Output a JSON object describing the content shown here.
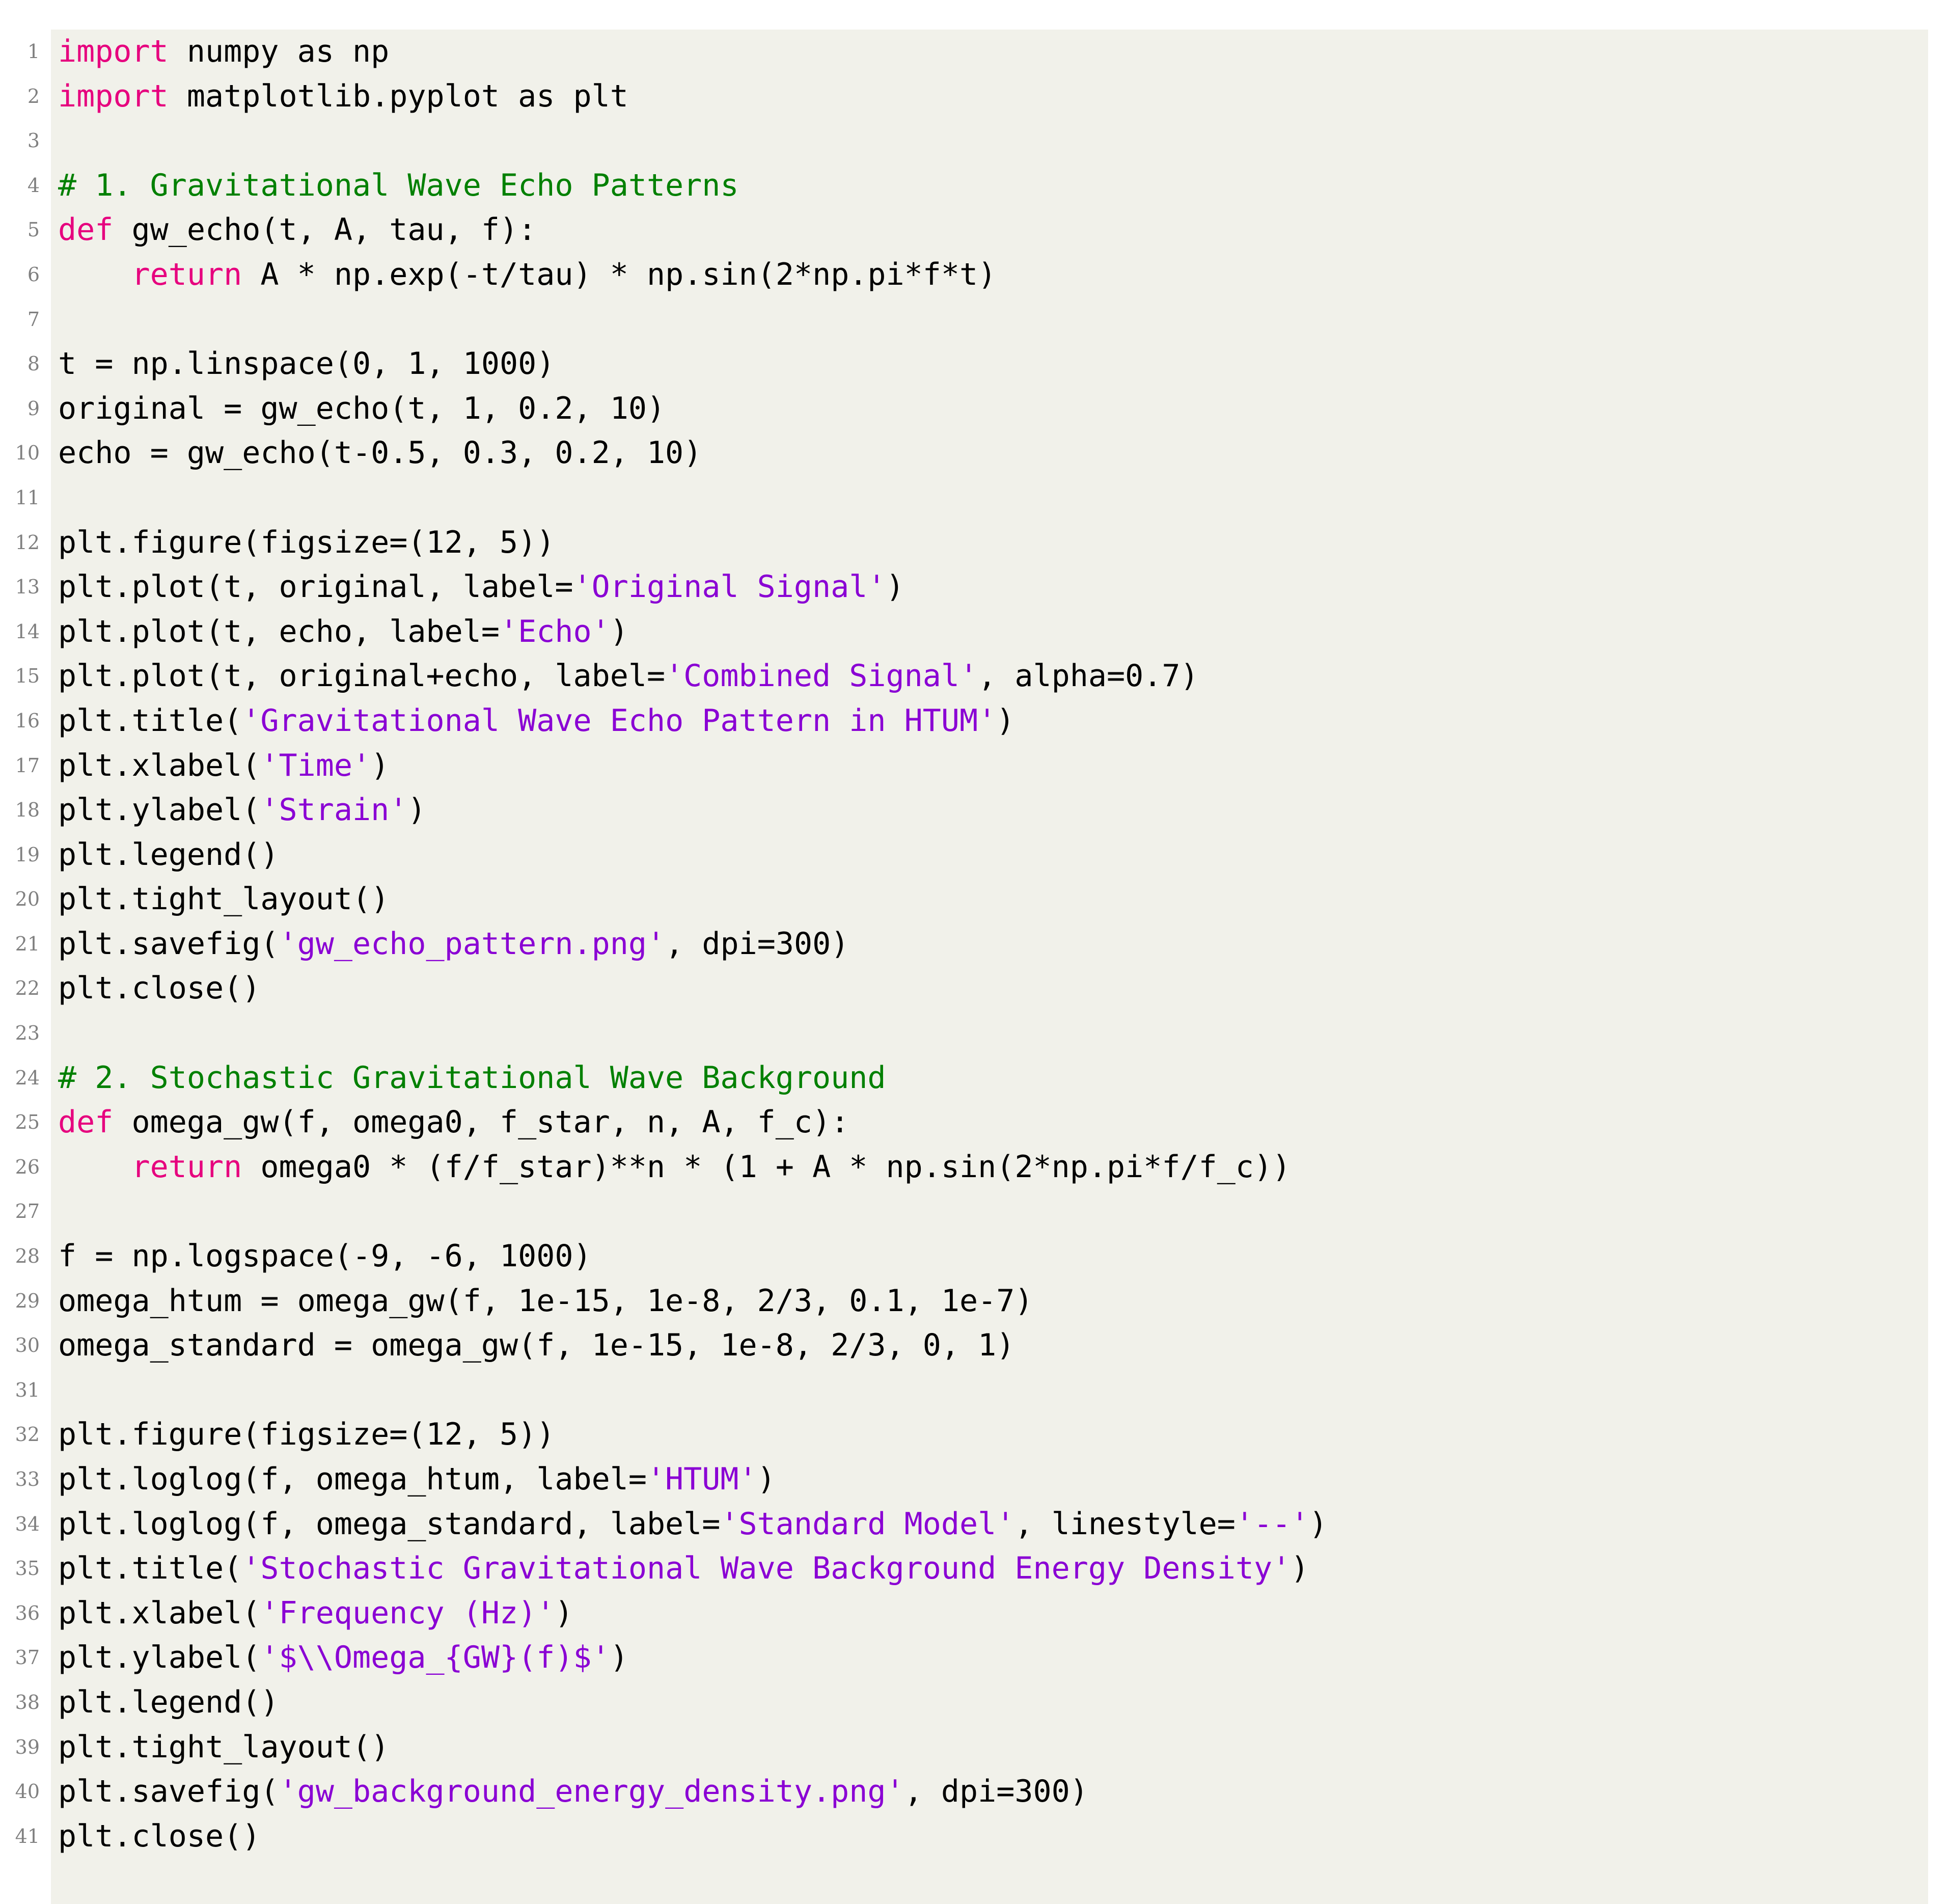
{
  "listing": {
    "language": "Python",
    "background_color": "#f1f1ea",
    "page_color": "#ffffff",
    "linenumber_color": "#808080",
    "colors": {
      "keyword": "#e6007e",
      "comment": "#008000",
      "string": "#8a00d4",
      "text": "#000000"
    },
    "first_line_number": 1,
    "last_line_number": 41,
    "lines": [
      {
        "n": "1",
        "tokens": [
          {
            "t": "import",
            "c": "kw"
          },
          {
            "t": " numpy as np",
            "c": "txt"
          }
        ]
      },
      {
        "n": "2",
        "tokens": [
          {
            "t": "import",
            "c": "kw"
          },
          {
            "t": " matplotlib.pyplot as plt",
            "c": "txt"
          }
        ]
      },
      {
        "n": "3",
        "tokens": []
      },
      {
        "n": "4",
        "tokens": [
          {
            "t": "# 1. Gravitational Wave Echo Patterns",
            "c": "com"
          }
        ]
      },
      {
        "n": "5",
        "tokens": [
          {
            "t": "def",
            "c": "kw"
          },
          {
            "t": " gw_echo(t, A, tau, f):",
            "c": "txt"
          }
        ]
      },
      {
        "n": "6",
        "tokens": [
          {
            "t": "    ",
            "c": "txt"
          },
          {
            "t": "return",
            "c": "kw"
          },
          {
            "t": " A * np.exp(-t/tau) * np.sin(2*np.pi*f*t)",
            "c": "txt"
          }
        ]
      },
      {
        "n": "7",
        "tokens": []
      },
      {
        "n": "8",
        "tokens": [
          {
            "t": "t = np.linspace(0, 1, 1000)",
            "c": "txt"
          }
        ]
      },
      {
        "n": "9",
        "tokens": [
          {
            "t": "original = gw_echo(t, 1, 0.2, 10)",
            "c": "txt"
          }
        ]
      },
      {
        "n": "10",
        "tokens": [
          {
            "t": "echo = gw_echo(t-0.5, 0.3, 0.2, 10)",
            "c": "txt"
          }
        ]
      },
      {
        "n": "11",
        "tokens": []
      },
      {
        "n": "12",
        "tokens": [
          {
            "t": "plt.figure(figsize=(12, 5))",
            "c": "txt"
          }
        ]
      },
      {
        "n": "13",
        "tokens": [
          {
            "t": "plt.plot(t, original, label=",
            "c": "txt"
          },
          {
            "t": "'Original Signal'",
            "c": "str"
          },
          {
            "t": ")",
            "c": "txt"
          }
        ]
      },
      {
        "n": "14",
        "tokens": [
          {
            "t": "plt.plot(t, echo, label=",
            "c": "txt"
          },
          {
            "t": "'Echo'",
            "c": "str"
          },
          {
            "t": ")",
            "c": "txt"
          }
        ]
      },
      {
        "n": "15",
        "tokens": [
          {
            "t": "plt.plot(t, original+echo, label=",
            "c": "txt"
          },
          {
            "t": "'Combined Signal'",
            "c": "str"
          },
          {
            "t": ", alpha=0.7)",
            "c": "txt"
          }
        ]
      },
      {
        "n": "16",
        "tokens": [
          {
            "t": "plt.title(",
            "c": "txt"
          },
          {
            "t": "'Gravitational Wave Echo Pattern in HTUM'",
            "c": "str"
          },
          {
            "t": ")",
            "c": "txt"
          }
        ]
      },
      {
        "n": "17",
        "tokens": [
          {
            "t": "plt.xlabel(",
            "c": "txt"
          },
          {
            "t": "'Time'",
            "c": "str"
          },
          {
            "t": ")",
            "c": "txt"
          }
        ]
      },
      {
        "n": "18",
        "tokens": [
          {
            "t": "plt.ylabel(",
            "c": "txt"
          },
          {
            "t": "'Strain'",
            "c": "str"
          },
          {
            "t": ")",
            "c": "txt"
          }
        ]
      },
      {
        "n": "19",
        "tokens": [
          {
            "t": "plt.legend()",
            "c": "txt"
          }
        ]
      },
      {
        "n": "20",
        "tokens": [
          {
            "t": "plt.tight_layout()",
            "c": "txt"
          }
        ]
      },
      {
        "n": "21",
        "tokens": [
          {
            "t": "plt.savefig(",
            "c": "txt"
          },
          {
            "t": "'gw_echo_pattern.png'",
            "c": "str"
          },
          {
            "t": ", dpi=300)",
            "c": "txt"
          }
        ]
      },
      {
        "n": "22",
        "tokens": [
          {
            "t": "plt.close()",
            "c": "txt"
          }
        ]
      },
      {
        "n": "23",
        "tokens": []
      },
      {
        "n": "24",
        "tokens": [
          {
            "t": "# 2. Stochastic Gravitational Wave Background",
            "c": "com"
          }
        ]
      },
      {
        "n": "25",
        "tokens": [
          {
            "t": "def",
            "c": "kw"
          },
          {
            "t": " omega_gw(f, omega0, f_star, n, A, f_c):",
            "c": "txt"
          }
        ]
      },
      {
        "n": "26",
        "tokens": [
          {
            "t": "    ",
            "c": "txt"
          },
          {
            "t": "return",
            "c": "kw"
          },
          {
            "t": " omega0 * (f/f_star)**n * (1 + A * np.sin(2*np.pi*f/f_c))",
            "c": "txt"
          }
        ]
      },
      {
        "n": "27",
        "tokens": []
      },
      {
        "n": "28",
        "tokens": [
          {
            "t": "f = np.logspace(-9, -6, 1000)",
            "c": "txt"
          }
        ]
      },
      {
        "n": "29",
        "tokens": [
          {
            "t": "omega_htum = omega_gw(f, 1e-15, 1e-8, 2/3, 0.1, 1e-7)",
            "c": "txt"
          }
        ]
      },
      {
        "n": "30",
        "tokens": [
          {
            "t": "omega_standard = omega_gw(f, 1e-15, 1e-8, 2/3, 0, 1)",
            "c": "txt"
          }
        ]
      },
      {
        "n": "31",
        "tokens": []
      },
      {
        "n": "32",
        "tokens": [
          {
            "t": "plt.figure(figsize=(12, 5))",
            "c": "txt"
          }
        ]
      },
      {
        "n": "33",
        "tokens": [
          {
            "t": "plt.loglog(f, omega_htum, label=",
            "c": "txt"
          },
          {
            "t": "'HTUM'",
            "c": "str"
          },
          {
            "t": ")",
            "c": "txt"
          }
        ]
      },
      {
        "n": "34",
        "tokens": [
          {
            "t": "plt.loglog(f, omega_standard, label=",
            "c": "txt"
          },
          {
            "t": "'Standard Model'",
            "c": "str"
          },
          {
            "t": ", linestyle=",
            "c": "txt"
          },
          {
            "t": "'--'",
            "c": "str"
          },
          {
            "t": ")",
            "c": "txt"
          }
        ]
      },
      {
        "n": "35",
        "tokens": [
          {
            "t": "plt.title(",
            "c": "txt"
          },
          {
            "t": "'Stochastic Gravitational Wave Background Energy Density'",
            "c": "str"
          },
          {
            "t": ")",
            "c": "txt"
          }
        ]
      },
      {
        "n": "36",
        "tokens": [
          {
            "t": "plt.xlabel(",
            "c": "txt"
          },
          {
            "t": "'Frequency (Hz)'",
            "c": "str"
          },
          {
            "t": ")",
            "c": "txt"
          }
        ]
      },
      {
        "n": "37",
        "tokens": [
          {
            "t": "plt.ylabel(",
            "c": "txt"
          },
          {
            "t": "'$\\\\Omega_{GW}(f)$'",
            "c": "str"
          },
          {
            "t": ")",
            "c": "txt"
          }
        ]
      },
      {
        "n": "38",
        "tokens": [
          {
            "t": "plt.legend()",
            "c": "txt"
          }
        ]
      },
      {
        "n": "39",
        "tokens": [
          {
            "t": "plt.tight_layout()",
            "c": "txt"
          }
        ]
      },
      {
        "n": "40",
        "tokens": [
          {
            "t": "plt.savefig(",
            "c": "txt"
          },
          {
            "t": "'gw_background_energy_density.png'",
            "c": "str"
          },
          {
            "t": ", dpi=300)",
            "c": "txt"
          }
        ]
      },
      {
        "n": "41",
        "tokens": [
          {
            "t": "plt.close()",
            "c": "txt"
          }
        ]
      }
    ]
  }
}
